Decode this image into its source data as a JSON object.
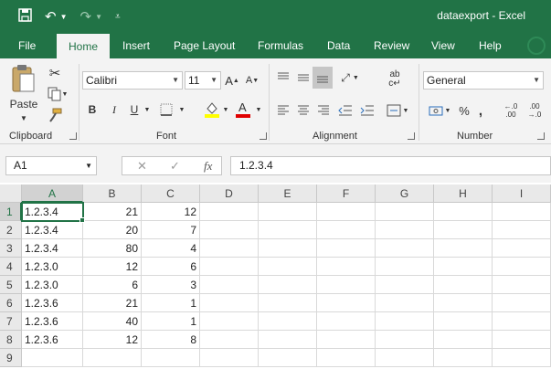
{
  "window": {
    "title": "dataexport  -  Excel"
  },
  "tabs": [
    "File",
    "Home",
    "Insert",
    "Page Layout",
    "Formulas",
    "Data",
    "Review",
    "View",
    "Help"
  ],
  "ribbon": {
    "clipboard": {
      "label": "Clipboard",
      "paste": "Paste"
    },
    "font": {
      "label": "Font",
      "family": "Calibri",
      "size": "11"
    },
    "alignment": {
      "label": "Alignment"
    },
    "number": {
      "label": "Number",
      "format": "General"
    }
  },
  "formula_bar": {
    "name_box": "A1",
    "formula": "1.2.3.4",
    "fx": "fx"
  },
  "sheet": {
    "columns": [
      "A",
      "B",
      "C",
      "D",
      "E",
      "F",
      "G",
      "H",
      "I"
    ],
    "rows": [
      {
        "num": "1",
        "a": "1.2.3.4",
        "b": "21",
        "c": "12"
      },
      {
        "num": "2",
        "a": "1.2.3.4",
        "b": "20",
        "c": "7"
      },
      {
        "num": "3",
        "a": "1.2.3.4",
        "b": "80",
        "c": "4"
      },
      {
        "num": "4",
        "a": "1.2.3.0",
        "b": "12",
        "c": "6"
      },
      {
        "num": "5",
        "a": "1.2.3.0",
        "b": "6",
        "c": "3"
      },
      {
        "num": "6",
        "a": "1.2.3.6",
        "b": "21",
        "c": "1"
      },
      {
        "num": "7",
        "a": "1.2.3.6",
        "b": "40",
        "c": "1"
      },
      {
        "num": "8",
        "a": "1.2.3.6",
        "b": "12",
        "c": "8"
      },
      {
        "num": "9",
        "a": "",
        "b": "",
        "c": ""
      }
    ]
  },
  "colors": {
    "accent": "#217346"
  }
}
